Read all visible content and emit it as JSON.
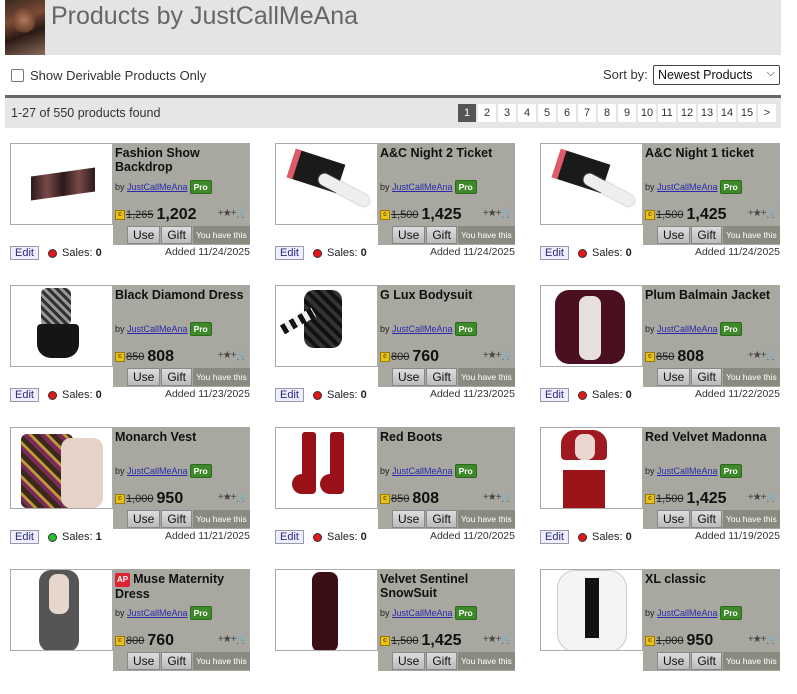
{
  "header": {
    "title": "Products by JustCallMeAna"
  },
  "filter": {
    "derivable_label": "Show Derivable Products Only",
    "sort_label": "Sort by:",
    "sort_value": "Newest Products"
  },
  "results": {
    "count_text": "1-27 of 550 products found",
    "pages": [
      "1",
      "2",
      "3",
      "4",
      "5",
      "6",
      "7",
      "8",
      "9",
      "10",
      "11",
      "12",
      "13",
      "14",
      "15",
      ">"
    ]
  },
  "labels": {
    "by": "by",
    "use": "Use",
    "gift": "Gift",
    "have": "You have this",
    "edit": "Edit",
    "sales": "Sales:",
    "pro": "Pro",
    "ap": "AP"
  },
  "products": [
    {
      "name": "Fashion Show Backdrop",
      "creator": "JustCallMeAna",
      "old_price": "1,265",
      "price": "1,202",
      "sales": "0",
      "sales_status": "red",
      "added": "Added 11/24/2025",
      "ap": false
    },
    {
      "name": "A&C Night 2 Ticket",
      "creator": "JustCallMeAna",
      "old_price": "1,500",
      "price": "1,425",
      "sales": "0",
      "sales_status": "red",
      "added": "Added 11/24/2025",
      "ap": false
    },
    {
      "name": "A&C Night 1 ticket",
      "creator": "JustCallMeAna",
      "old_price": "1,500",
      "price": "1,425",
      "sales": "0",
      "sales_status": "red",
      "added": "Added 11/24/2025",
      "ap": false
    },
    {
      "name": "Black Diamond Dress",
      "creator": "JustCallMeAna",
      "old_price": "850",
      "price": "808",
      "sales": "0",
      "sales_status": "red",
      "added": "Added 11/23/2025",
      "ap": false
    },
    {
      "name": "G Lux Bodysuit",
      "creator": "JustCallMeAna",
      "old_price": "800",
      "price": "760",
      "sales": "0",
      "sales_status": "red",
      "added": "Added 11/23/2025",
      "ap": false
    },
    {
      "name": "Plum Balmain Jacket",
      "creator": "JustCallMeAna",
      "old_price": "850",
      "price": "808",
      "sales": "0",
      "sales_status": "red",
      "added": "Added 11/22/2025",
      "ap": false
    },
    {
      "name": "Monarch Vest",
      "creator": "JustCallMeAna",
      "old_price": "1,000",
      "price": "950",
      "sales": "1",
      "sales_status": "green",
      "added": "Added 11/21/2025",
      "ap": false
    },
    {
      "name": "Red Boots",
      "creator": "JustCallMeAna",
      "old_price": "850",
      "price": "808",
      "sales": "0",
      "sales_status": "red",
      "added": "Added 11/20/2025",
      "ap": false
    },
    {
      "name": "Red Velvet Madonna",
      "creator": "JustCallMeAna",
      "old_price": "1,500",
      "price": "1,425",
      "sales": "0",
      "sales_status": "red",
      "added": "Added 11/19/2025",
      "ap": false
    },
    {
      "name": "Muse Maternity Dress",
      "creator": "JustCallMeAna",
      "old_price": "800",
      "price": "760",
      "ap": true
    },
    {
      "name": "Velvet Sentinel SnowSuit",
      "creator": "JustCallMeAna",
      "old_price": "1,500",
      "price": "1,425",
      "ap": false
    },
    {
      "name": "XL classic",
      "creator": "JustCallMeAna",
      "old_price": "1,000",
      "price": "950",
      "ap": false
    }
  ]
}
